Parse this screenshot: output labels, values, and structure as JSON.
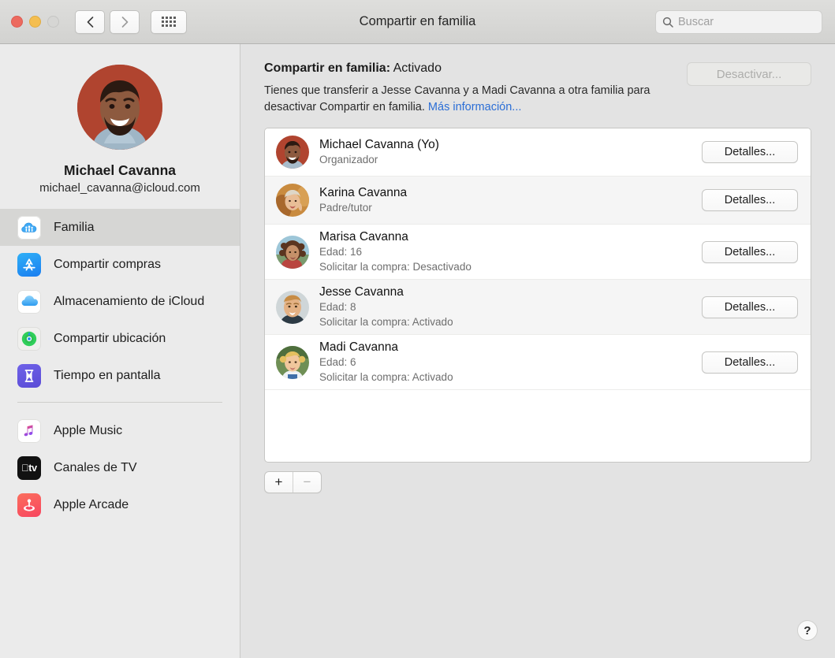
{
  "window": {
    "title": "Compartir en familia",
    "traffic_lights": [
      "close",
      "minimize",
      "zoom"
    ],
    "nav": {
      "back_icon": "chevron-left-icon",
      "forward_icon": "chevron-right-icon",
      "grid_icon": "grid-icon"
    }
  },
  "search": {
    "placeholder": "Buscar",
    "value": "",
    "icon": "search-icon"
  },
  "sidebar": {
    "profile": {
      "name": "Michael Cavanna",
      "email": "michael_cavanna@icloud.com",
      "avatar": "avatar-michael"
    },
    "items": [
      {
        "label": "Familia",
        "icon": "family-icon",
        "selected": true
      },
      {
        "label": "Compartir compras",
        "icon": "app-store-icon",
        "selected": false
      },
      {
        "label": "Almacenamiento de iCloud",
        "icon": "icloud-icon",
        "selected": false
      },
      {
        "label": "Compartir ubicación",
        "icon": "find-my-icon",
        "selected": false
      },
      {
        "label": "Tiempo en pantalla",
        "icon": "screen-time-icon",
        "selected": false
      }
    ],
    "items_secondary": [
      {
        "label": "Apple Music",
        "icon": "apple-music-icon"
      },
      {
        "label": "Canales de TV",
        "icon": "apple-tv-icon"
      },
      {
        "label": "Apple Arcade",
        "icon": "apple-arcade-icon"
      }
    ]
  },
  "main": {
    "status_label": "Compartir en familia:",
    "status_value": "Activado",
    "turn_off_button": "Desactivar...",
    "description_part1": "Tienes que transferir a Jesse Cavanna y a Madi Cavanna a otra familia para desactivar Compartir en familia.",
    "description_link": "Más información...",
    "members": [
      {
        "name": "Michael Cavanna (Yo)",
        "line1": "Organizador",
        "line2": "",
        "button": "Detalles...",
        "avatar": "avatar-michael"
      },
      {
        "name": "Karina Cavanna",
        "line1": "Padre/tutor",
        "line2": "",
        "button": "Detalles...",
        "avatar": "avatar-karina"
      },
      {
        "name": "Marisa Cavanna",
        "line1": "Edad: 16",
        "line2": "Solicitar la compra: Desactivado",
        "button": "Detalles...",
        "avatar": "avatar-marisa"
      },
      {
        "name": "Jesse Cavanna",
        "line1": "Edad: 8",
        "line2": "Solicitar la compra: Activado",
        "button": "Detalles...",
        "avatar": "avatar-jesse"
      },
      {
        "name": "Madi Cavanna",
        "line1": "Edad: 6",
        "line2": "Solicitar la compra: Activado",
        "button": "Detalles...",
        "avatar": "avatar-madi"
      }
    ],
    "add_button": "+",
    "remove_button": "−",
    "help_button": "?"
  },
  "colors": {
    "accent_link": "#2b6ed6",
    "window_bg": "#e3e3e3",
    "sidebar_bg": "#ebebeb",
    "selected_row": "#d6d6d4",
    "list_bg": "#ffffff",
    "alt_row": "#f5f5f5"
  }
}
